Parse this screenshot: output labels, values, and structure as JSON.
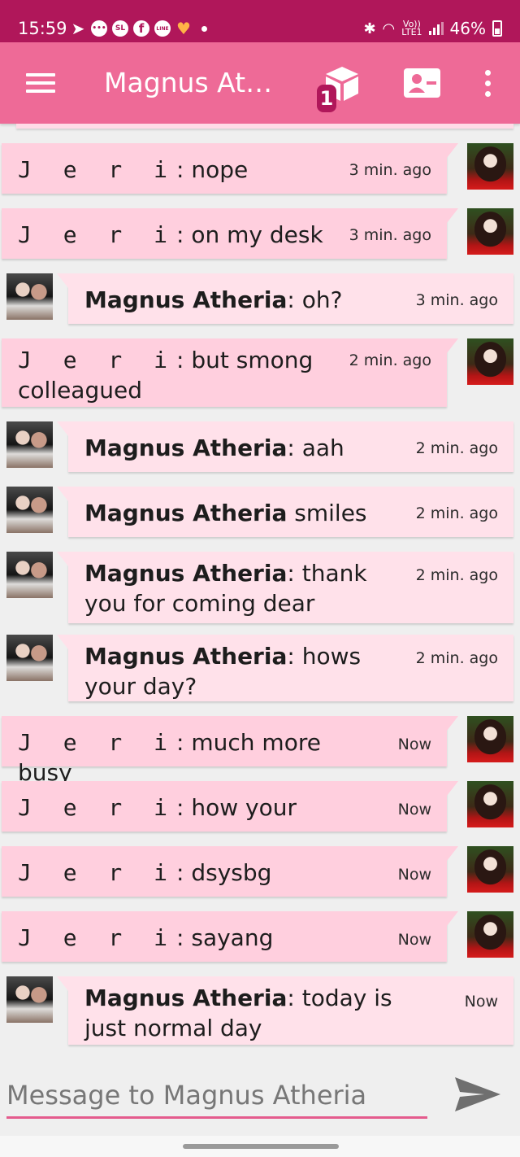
{
  "status_bar": {
    "time": "15:59",
    "notification_icons": [
      "telegram-icon",
      "chat-icon",
      "sl-icon",
      "facebook-icon",
      "line-icon",
      "heart-icon"
    ],
    "sl_label": "SL",
    "line_label": "LINE",
    "volte_label_1": "Vo))",
    "volte_label_2": "LTE1",
    "battery": "46%"
  },
  "app_bar": {
    "title": "Magnus Ath...",
    "badge_count": "1",
    "accent_color": "#ee6a97",
    "dark_color": "#b0175a"
  },
  "messages": [
    {
      "sender": "jeri",
      "name": "J e r i",
      "separator": ": ",
      "text": "nope",
      "time": "3 min. ago"
    },
    {
      "sender": "jeri",
      "name": "J e r i",
      "separator": ": ",
      "text": "on my desk",
      "time": "3 min. ago"
    },
    {
      "sender": "magnus",
      "name": "Magnus Atheria",
      "separator": ": ",
      "text": "oh?",
      "time": "3 min. ago"
    },
    {
      "sender": "jeri",
      "name": "J e r i",
      "separator": ": ",
      "text": "but smong colleagued",
      "time": "2 min. ago"
    },
    {
      "sender": "magnus",
      "name": "Magnus Atheria",
      "separator": ": ",
      "text": "aah",
      "time": "2 min. ago"
    },
    {
      "sender": "magnus",
      "name": "Magnus Atheria",
      "separator": " ",
      "text": "smiles",
      "time": "2 min. ago"
    },
    {
      "sender": "magnus",
      "name": "Magnus Atheria",
      "separator": ": ",
      "text": "thank you for coming dear",
      "time": "2 min. ago"
    },
    {
      "sender": "magnus",
      "name": "Magnus Atheria",
      "separator": ": ",
      "text": "hows your day?",
      "time": "2 min. ago"
    },
    {
      "sender": "jeri",
      "name": "J e r i",
      "separator": ": ",
      "text": "much more busy",
      "time": "Now"
    },
    {
      "sender": "jeri",
      "name": "J e r i",
      "separator": ": ",
      "text": "how your",
      "time": "Now"
    },
    {
      "sender": "jeri",
      "name": "J e r i",
      "separator": ": ",
      "text": "dsysbg",
      "time": "Now"
    },
    {
      "sender": "jeri",
      "name": "J e r i",
      "separator": ": ",
      "text": "sayang",
      "time": "Now"
    },
    {
      "sender": "magnus",
      "name": "Magnus Atheria",
      "separator": ": ",
      "text": "today is just normal day",
      "time": "Now"
    }
  ],
  "composer": {
    "placeholder": "Message to Magnus Atheria",
    "value": ""
  }
}
